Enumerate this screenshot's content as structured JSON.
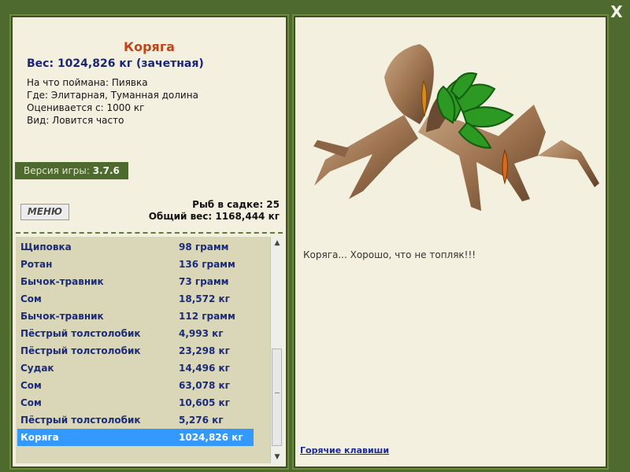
{
  "window": {
    "close_label": "X"
  },
  "catch": {
    "title": "Коряга",
    "weight": "Вес: 1024,826 кг (зачетная)",
    "caught_on": "На что поймана: Пиявка",
    "where": "Где: Элитарная, Туманная долина",
    "rated_from": "Оценивается с: 1000 кг",
    "kind": "Вид: Ловится часто",
    "comment": "Коряга... Хорошо, что не топляк!!!"
  },
  "version": {
    "label": "Версия игры:",
    "value": "3.7.6"
  },
  "menu": {
    "label": "МЕНЮ"
  },
  "sadok": {
    "fish_count": "Рыб в садке: 25",
    "total_weight": "Общий вес: 1168,444 кг"
  },
  "list": [
    {
      "name": "Щиповка",
      "weight": "98 грамм"
    },
    {
      "name": "Ротан",
      "weight": "136 грамм"
    },
    {
      "name": "Бычок-травник",
      "weight": "73 грамм"
    },
    {
      "name": "Сом",
      "weight": "18,572 кг"
    },
    {
      "name": "Бычок-травник",
      "weight": "112 грамм"
    },
    {
      "name": "Пёстрый толстолобик",
      "weight": "4,993 кг"
    },
    {
      "name": "Пёстрый толстолобик",
      "weight": "23,298 кг"
    },
    {
      "name": "Судак",
      "weight": "14,496 кг"
    },
    {
      "name": "Сом",
      "weight": "63,078 кг"
    },
    {
      "name": "Сом",
      "weight": "10,605 кг"
    },
    {
      "name": "Пёстрый толстолобик",
      "weight": "5,276 кг"
    },
    {
      "name": "Коряга",
      "weight": "1024,826 кг"
    }
  ],
  "selected_index": 11,
  "hotkeys": {
    "label": "Горячие клавиши"
  },
  "colors": {
    "frame": "#4e6a2e",
    "panel": "#f3f0df",
    "list_bg": "#d9d7b7",
    "selection": "#3399ff",
    "title": "#c2451a",
    "weight": "#1a2478"
  }
}
